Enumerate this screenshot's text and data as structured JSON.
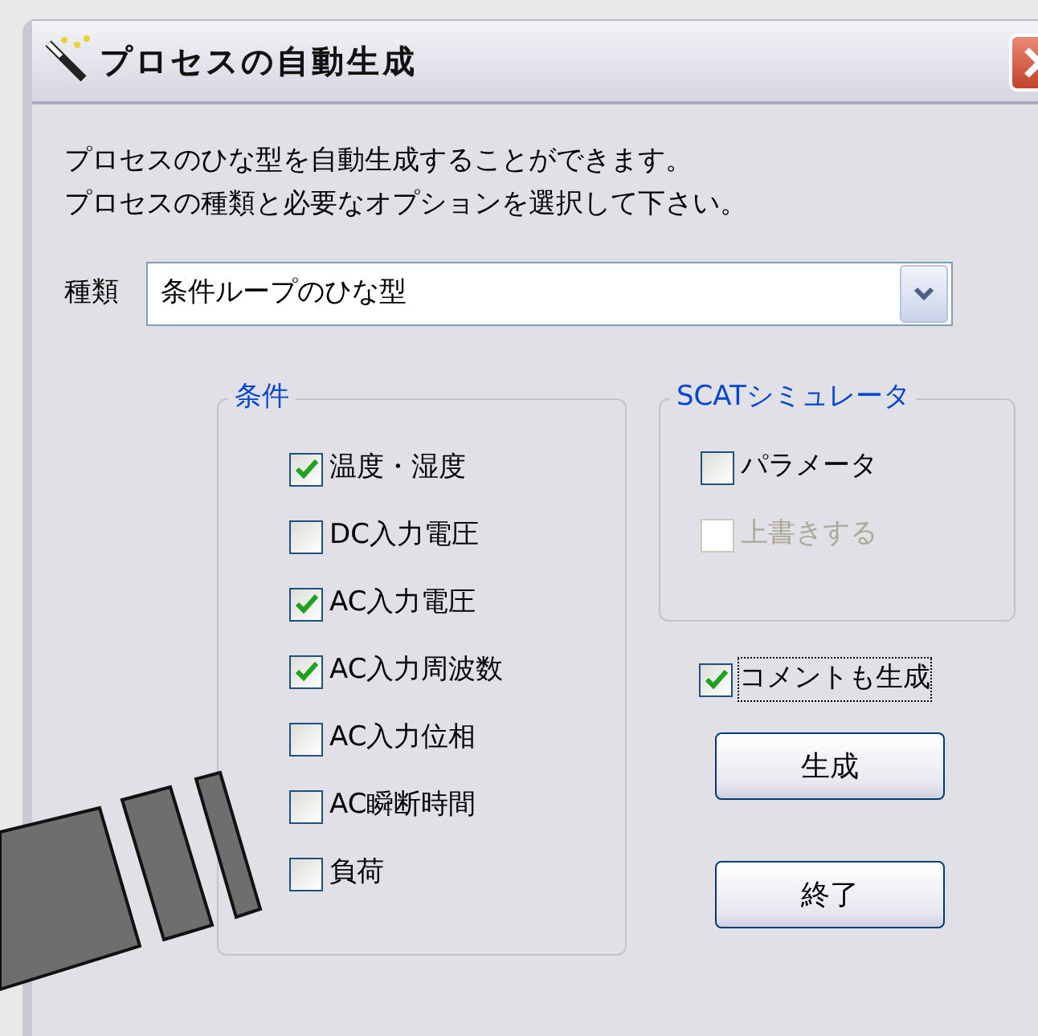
{
  "window": {
    "title": "プロセスの自動生成"
  },
  "description": [
    "プロセスのひな型を自動生成することができます。",
    "プロセスの種類と必要なオプションを選択して下さい。"
  ],
  "type_field": {
    "label": "種類",
    "value": "条件ループのひな型"
  },
  "conditions": {
    "title": "条件",
    "items": [
      {
        "label": "温度・湿度",
        "checked": true
      },
      {
        "label": "DC入力電圧",
        "checked": false
      },
      {
        "label": "AC入力電圧",
        "checked": true
      },
      {
        "label": "AC入力周波数",
        "checked": true
      },
      {
        "label": "AC入力位相",
        "checked": false
      },
      {
        "label": "AC瞬断時間",
        "checked": false
      },
      {
        "label": "負荷",
        "checked": false
      }
    ]
  },
  "scat": {
    "title": "SCATシミュレータ",
    "items": [
      {
        "label": "パラメータ",
        "checked": false,
        "disabled": false
      },
      {
        "label": "上書きする",
        "checked": false,
        "disabled": true
      }
    ]
  },
  "comment_option": {
    "label": "コメントも生成",
    "checked": true,
    "focused": true
  },
  "buttons": [
    "生成",
    "終了"
  ]
}
